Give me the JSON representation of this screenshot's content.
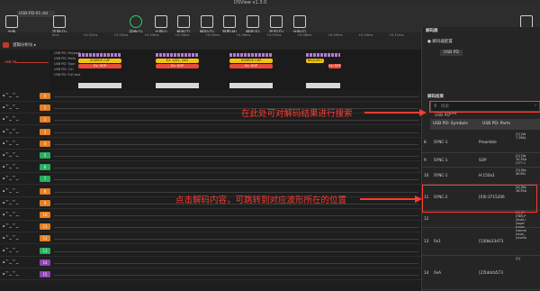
{
  "app": {
    "title": "DSView v1.3.0",
    "file_tab": "USB-PD-01.dsl"
  },
  "toolbar": [
    {
      "label": "文件",
      "icon": "file-icon"
    },
    {
      "label": "选项(O)",
      "icon": "options-icon"
    },
    {
      "label": "开始(S)",
      "icon": "start-icon"
    },
    {
      "label": "立即(I)",
      "icon": "instant-icon"
    },
    {
      "label": "触发(T)",
      "icon": "trigger-icon"
    },
    {
      "label": "解码(D)",
      "icon": "decode-icon"
    },
    {
      "label": "测量(M)",
      "icon": "measure-icon"
    },
    {
      "label": "搜索(R)",
      "icon": "search-icon"
    },
    {
      "label": "显示(D)",
      "icon": "display-icon"
    },
    {
      "label": "文件(F)",
      "icon": "file-menu-icon"
    },
    {
      "label": "帮助(H)",
      "icon": "help-icon"
    }
  ],
  "ruler_ticks": [
    "0ms",
    "+0.01ms",
    "+0.02ms",
    "+0.03ms",
    "+0.04ms",
    "+0.05ms",
    "+0.06ms",
    "+0.07ms",
    "+0.08ms",
    "+0.09ms",
    "+0.10ms",
    "+0.11ms"
  ],
  "group": {
    "label": "逻辑分析仪 ▸"
  },
  "usb_label": "USB PD",
  "decoder_rows": [
    "USB PD: Payload",
    "USB PD: Parts",
    "USB PD: Type",
    "USB PD: Ctrl",
    "USB PD: Full text"
  ],
  "decoder_pills": [
    "SOURCE CAP",
    "Ex: SOP",
    "Ex: 1(D) : DAT",
    "Ex: SOP",
    "SOURCE CAP",
    "Ex: SOP",
    "REQUEST",
    "Ex: SOP"
  ],
  "channels": [
    {
      "id": "0",
      "color": "#e67e22"
    },
    {
      "id": "1",
      "color": "#e67e22"
    },
    {
      "id": "2",
      "color": "#e67e22"
    },
    {
      "id": "3",
      "color": "#e67e22"
    },
    {
      "id": "4",
      "color": "#e67e22"
    },
    {
      "id": "5",
      "color": "#27ae60"
    },
    {
      "id": "6",
      "color": "#27ae60"
    },
    {
      "id": "7",
      "color": "#27ae60"
    },
    {
      "id": "8",
      "color": "#e67e22"
    },
    {
      "id": "9",
      "color": "#e67e22"
    },
    {
      "id": "10",
      "color": "#e67e22"
    },
    {
      "id": "11",
      "color": "#e67e22"
    },
    {
      "id": "12",
      "color": "#e67e22"
    },
    {
      "id": "13",
      "color": "#27ae60"
    },
    {
      "id": "14",
      "color": "#8e44ad"
    },
    {
      "id": "15",
      "color": "#8e44ad"
    }
  ],
  "right_panel": {
    "decoder_title": "解码器",
    "decoder_sub": "● 解码器配置",
    "decoder_entry": "USB PD",
    "results_title": "解码结果",
    "search_placeholder": "搜索",
    "sub_label": "USB PD",
    "count": "494",
    "columns": [
      "USB PD: Symbols",
      "USB PD: Parts"
    ],
    "rows": [
      {
        "idx": "8",
        "c1": "SYNC-1",
        "c2": "Preamble",
        "c3": "[1] [Va\n7.26A]"
      },
      {
        "idx": "9",
        "c1": "SYNC-1",
        "c2": "SOP",
        "c3": "[2] [Va\n10.35A\n(177.1"
      },
      {
        "idx": "10",
        "c1": "SYNC-1",
        "c2": "H:150a1",
        "c3": "[3] [Ba\n40.65/"
      },
      {
        "idx": "11",
        "c1": "SYNC-2",
        "c2": "[0]0:3715206",
        "c3": "[4] [Ba\n16.95A"
      },
      {
        "idx": "12",
        "c1": "",
        "c2": "",
        "c3": "[5] [Fi\n(9W),P\n(dual_r\n(supe\n(unco\n(comm\n(dual_\n(uncha"
      },
      {
        "idx": "13",
        "c1": "0x1",
        "c2": "[1]0bb33d73",
        "c3": ""
      },
      {
        "idx": "14",
        "c1": "0xA",
        "c2": "[2]5ddcb573",
        "c3": "[1]"
      }
    ]
  },
  "annotations": {
    "search_hint": "在此处可对解码结果进行搜索",
    "jump_hint": "点击解码内容，可跳转到对应波形所在的位置"
  }
}
